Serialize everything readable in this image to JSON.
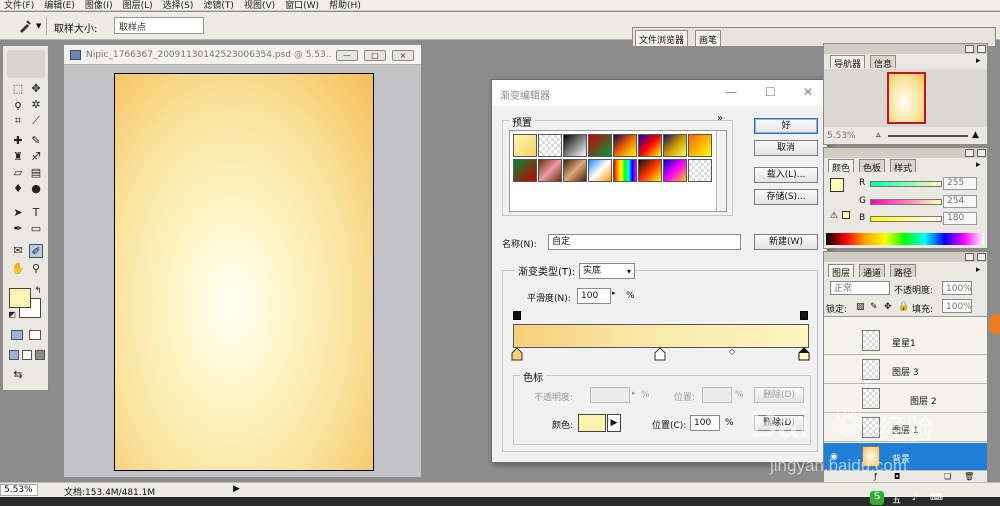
{
  "menu": [
    "文件(F)",
    "编辑(E)",
    "图像(I)",
    "图层(L)",
    "选择(S)",
    "滤镜(T)",
    "视图(V)",
    "窗口(W)",
    "帮助(H)"
  ],
  "options_bar": {
    "sample_size_label": "取样大小:",
    "sample_size_value": "取样点",
    "well_tabs": [
      "文件浏览器",
      "画笔"
    ]
  },
  "document": {
    "title": "Nipic_1766367_20091130142523006354.psd @ 5.53...",
    "window_buttons": [
      "—",
      "□",
      "×"
    ]
  },
  "status": {
    "zoom": "5.53%",
    "doc_info": "文档:153.4M/481.1M"
  },
  "gradient_editor": {
    "title": "渐变编辑器",
    "presets_label": "预置",
    "presets_menu": "»",
    "preset_swatches": [
      "linear-gradient(135deg,#fff8b0,#f3d469)",
      "repeating-conic-gradient(#ddd 0 25%,#fff 0 50%) 0 0/6px 6px",
      "linear-gradient(135deg,#000,#fff)",
      "linear-gradient(135deg,#c00,#094)",
      "linear-gradient(135deg,#204,#e60,#ff0)",
      "linear-gradient(135deg,#10a,#f00,#ff0)",
      "linear-gradient(135deg,#116,#c90,#ff6)",
      "linear-gradient(135deg,#f60,#ff0)",
      "linear-gradient(135deg,#083,#c00)",
      "linear-gradient(135deg,#630,#e9a,#630)",
      "linear-gradient(135deg,#421,#da7,#421)",
      "linear-gradient(135deg,#28f,#fff,#f90)",
      "linear-gradient(90deg,red,orange,yellow,lime,cyan,blue,magenta)",
      "linear-gradient(135deg,#111,#f30,#ff0)",
      "linear-gradient(135deg,#00c,#f0f,#fc0)",
      "repeating-conic-gradient(#ddd 0 25%,#fff 0 50%) 0 0/6px 6px"
    ],
    "buttons": {
      "ok": "好",
      "cancel": "取消",
      "load": "载入(L)...",
      "save": "存储(S)...",
      "new": "新建(W)"
    },
    "name_label": "名称(N):",
    "name_value": "自定",
    "gradient_type_label": "渐变类型(T):",
    "gradient_type_value": "实底",
    "smoothness_label": "平滑度(N):",
    "smoothness_value": "100",
    "smoothness_unit": "%",
    "stops_label": "色标",
    "opacity_label": "不透明度:",
    "opacity_unit": "%",
    "opacity_location_label": "位置:",
    "opacity_location_unit": "%",
    "opacity_delete": "删除(D)",
    "color_label": "颜色:",
    "color_location_label": "位置(C):",
    "color_location_value": "100",
    "color_location_unit": "%",
    "color_delete": "删除(D)",
    "gradient_css": "linear-gradient(90deg,#f7cf7a 0%,#f9e7a6 40%,#fdf6c2 100%)",
    "start_color": "#f7cf7a",
    "end_color": "#fdf6c2"
  },
  "navigator_panel": {
    "tabs": [
      "导航器",
      "信息"
    ],
    "zoom": "5.53%"
  },
  "color_panel": {
    "tabs": [
      "颜色",
      "色板",
      "样式"
    ],
    "channels": [
      {
        "label": "R",
        "value": "255",
        "track": "linear-gradient(90deg,#00ffb4,#ffffb4)"
      },
      {
        "label": "G",
        "value": "254",
        "track": "linear-gradient(90deg,#ff00b4,#ffffb4)"
      },
      {
        "label": "B",
        "value": "180",
        "track": "linear-gradient(90deg,#fffe00,#fffeff)"
      }
    ],
    "foreground": "#fffeb4"
  },
  "layers_panel": {
    "tabs": [
      "图层",
      "通道",
      "路径"
    ],
    "blend_mode": "正常",
    "opacity_label": "不透明度:",
    "opacity_value": "100%",
    "lock_label": "锁定:",
    "fill_label": "填充:",
    "fill_value": "100%",
    "layers": [
      "星星1",
      "图层 3",
      "图层 2",
      "图层 1",
      "背景"
    ]
  },
  "watermark": {
    "brand": "Bai",
    "brand_suffix": "经验",
    "url": "jingyan.baidu.com"
  },
  "taskbar_ime": [
    "五",
    "♪",
    "⌨"
  ]
}
